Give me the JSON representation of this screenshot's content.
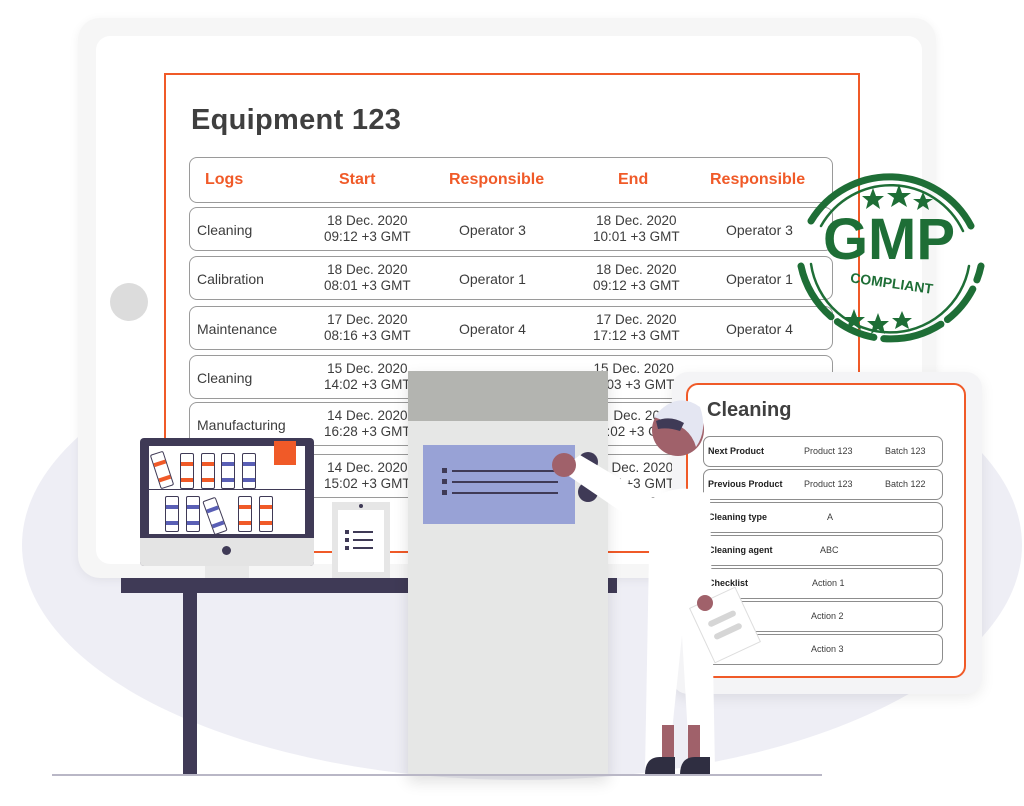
{
  "equipment_panel": {
    "title": "Equipment 123",
    "columns": [
      "Logs",
      "Start",
      "Responsible",
      "End",
      "Responsible"
    ],
    "rows": [
      {
        "log": "Cleaning",
        "start_date": "18 Dec. 2020",
        "start_time": "09:12 +3 GMT",
        "start_responsible": "Operator 3",
        "end_date": "18 Dec. 2020",
        "end_time": "10:01 +3 GMT",
        "end_responsible": "Operator 3"
      },
      {
        "log": "Calibration",
        "start_date": "18 Dec. 2020",
        "start_time": "08:01 +3 GMT",
        "start_responsible": "Operator 1",
        "end_date": "18 Dec. 2020",
        "end_time": "09:12 +3 GMT",
        "end_responsible": "Operator 1"
      },
      {
        "log": "Maintenance",
        "start_date": "17 Dec. 2020",
        "start_time": "08:16 +3 GMT",
        "start_responsible": "Operator 4",
        "end_date": "17 Dec. 2020",
        "end_time": "17:12 +3 GMT",
        "end_responsible": "Operator 4"
      },
      {
        "log": "Cleaning",
        "start_date": "15 Dec. 2020",
        "start_time": "14:02 +3 GMT",
        "start_responsible": "",
        "end_date": "15 Dec. 2020",
        "end_time": "…03 +3 GMT",
        "end_responsible": ""
      },
      {
        "log": "Manufacturing",
        "start_date": "14 Dec. 2020",
        "start_time": "16:28 +3 GMT",
        "start_responsible": "",
        "end_date": "… Dec. 2020",
        "end_time": "…:02 +3 GMT",
        "end_responsible": ""
      },
      {
        "log": "",
        "start_date": "14 Dec. 2020",
        "start_time": "15:02 +3 GMT",
        "start_responsible": "",
        "end_date": "… Dec. 2020",
        "end_time": "…07 +3 GMT",
        "end_responsible": ""
      }
    ]
  },
  "cleaning_card": {
    "title": "Cleaning",
    "rows": [
      {
        "label": "Next Product",
        "value": "Product 123",
        "extra": "Batch 123"
      },
      {
        "label": "Previous Product",
        "value": "Product 123",
        "extra": "Batch 122"
      },
      {
        "label": "Cleaning type",
        "value": "A",
        "extra": ""
      },
      {
        "label": "Cleaning agent",
        "value": "ABC",
        "extra": ""
      },
      {
        "label": "Checklist",
        "value": "Action 1",
        "extra": ""
      },
      {
        "label": "",
        "value": "Action 2",
        "extra": ""
      },
      {
        "label": "",
        "value": "Action 3",
        "extra": ""
      }
    ]
  },
  "stamp": {
    "main_text": "GMP",
    "sub_text": "COMPLIANT",
    "color": "#1e6e36"
  },
  "colors": {
    "accent": "#f05a28",
    "dark": "#3f3a56",
    "lavender": "#98a2d6",
    "blob": "#eeeef5"
  }
}
